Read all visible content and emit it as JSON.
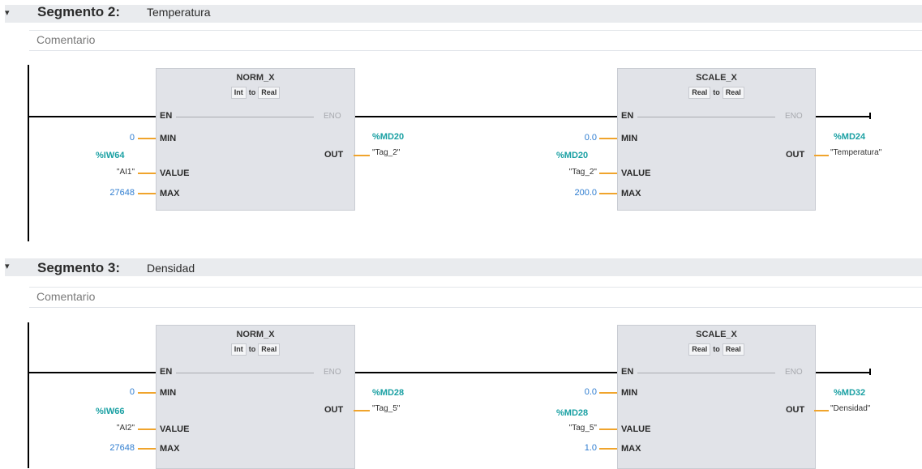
{
  "segments": [
    {
      "title": "Segmento 2:",
      "name": "Temperatura",
      "comment": "Comentario",
      "norm": {
        "title": "NORM_X",
        "from": "Int",
        "to_word": "to",
        "to": "Real",
        "en": "EN",
        "eno": "ENO",
        "min": "MIN",
        "value": "VALUE",
        "max": "MAX",
        "out": "OUT",
        "min_val": "0",
        "value_addr": "%IW64",
        "value_tag": "\"AI1\"",
        "max_val": "27648",
        "out_addr": "%MD20",
        "out_tag": "\"Tag_2\""
      },
      "scale": {
        "title": "SCALE_X",
        "from": "Real",
        "to_word": "to",
        "to": "Real",
        "en": "EN",
        "eno": "ENO",
        "min": "MIN",
        "value": "VALUE",
        "max": "MAX",
        "out": "OUT",
        "min_val": "0.0",
        "value_addr": "%MD20",
        "value_tag": "\"Tag_2\"",
        "max_val": "200.0",
        "out_addr": "%MD24",
        "out_tag": "\"Temperatura\""
      }
    },
    {
      "title": "Segmento 3:",
      "name": "Densidad",
      "comment": "Comentario",
      "norm": {
        "title": "NORM_X",
        "from": "Int",
        "to_word": "to",
        "to": "Real",
        "en": "EN",
        "eno": "ENO",
        "min": "MIN",
        "value": "VALUE",
        "max": "MAX",
        "out": "OUT",
        "min_val": "0",
        "value_addr": "%IW66",
        "value_tag": "\"AI2\"",
        "max_val": "27648",
        "out_addr": "%MD28",
        "out_tag": "\"Tag_5\""
      },
      "scale": {
        "title": "SCALE_X",
        "from": "Real",
        "to_word": "to",
        "to": "Real",
        "en": "EN",
        "eno": "ENO",
        "min": "MIN",
        "value": "VALUE",
        "max": "MAX",
        "out": "OUT",
        "min_val": "0.0",
        "value_addr": "%MD28",
        "value_tag": "\"Tag_5\"",
        "max_val": "1.0",
        "out_addr": "%MD32",
        "out_tag": "\"Densidad\""
      }
    }
  ],
  "colors": {
    "address": "#1aa0a3",
    "constant": "#2f7dd0",
    "wire_pin": "#f0a42c",
    "block": "#e1e3e8"
  }
}
